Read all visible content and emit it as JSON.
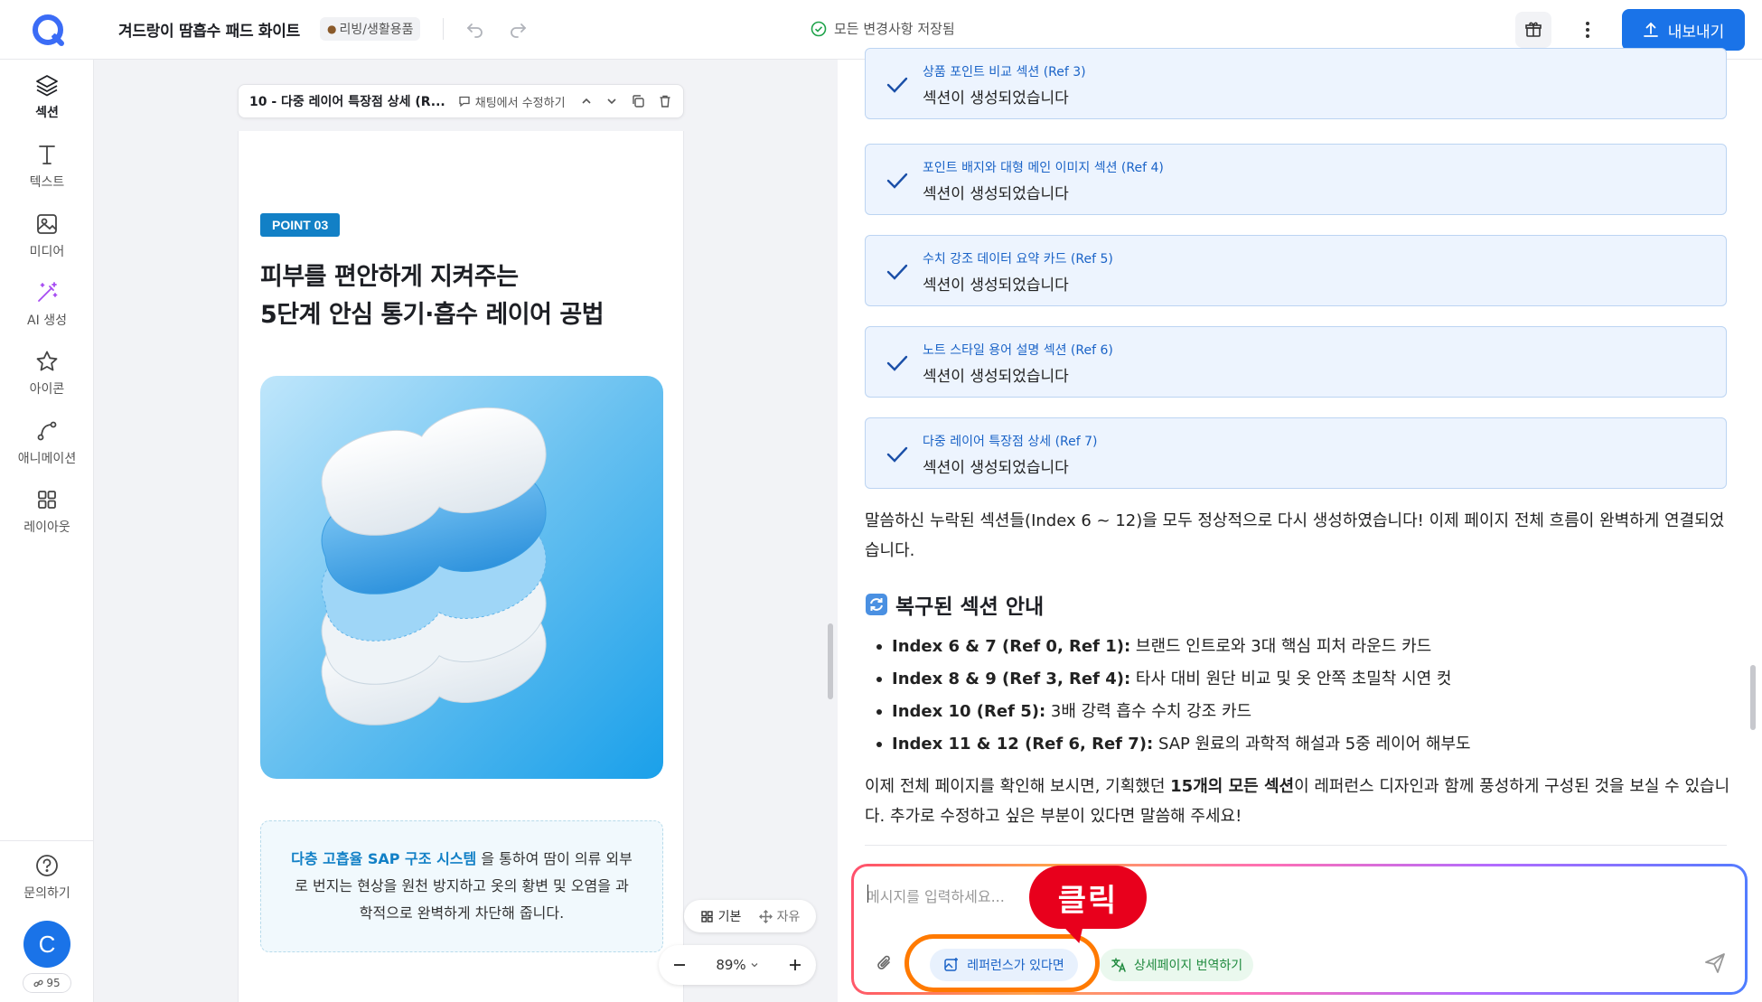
{
  "app": {
    "doc_title": "겨드랑이 땀흡수 패드 화이트",
    "category": "리빙/생활용품",
    "save_status": "모든 변경사항 저장됨",
    "export_label": "내보내기",
    "accent_color": "#1a73e8"
  },
  "sidebar": {
    "items": [
      {
        "label": "섹션",
        "icon": "layers-icon"
      },
      {
        "label": "텍스트",
        "icon": "text-icon"
      },
      {
        "label": "미디어",
        "icon": "image-icon"
      },
      {
        "label": "AI 생성",
        "icon": "magic-wand-icon"
      },
      {
        "label": "아이콘",
        "icon": "star-icon"
      },
      {
        "label": "애니메이션",
        "icon": "curve-icon"
      },
      {
        "label": "레이아웃",
        "icon": "grid-icon"
      }
    ],
    "help_label": "문의하기",
    "avatar_initial": "C",
    "credits": "95"
  },
  "editor": {
    "section_title": "10 - 다중 레이어 특장점 상세 (R...",
    "edit_in_chat": "채팅에서 수정하기",
    "point_badge": "POINT 03",
    "headline_line1": "피부를 편안하게 지켜주는",
    "headline_line2": "5단계 안심 통기·흡수 레이어 공법",
    "desc_highlight": "다층 고흡율 SAP 구조 시스템",
    "desc_rest": " 을 통하여 땀이 의류 외부로 번지는 현상을 원천 방지하고 옷의 황변 및 오염을 과학적으로 완벽하게 차단해 줍니다.",
    "mode_basic": "기본",
    "mode_free": "자유",
    "zoom": "89%"
  },
  "chat": {
    "cards": [
      {
        "title": "상품 포인트 비교 섹션 (Ref 3)",
        "status": "섹션이 생성되었습니다"
      },
      {
        "title": "포인트 배지와 대형 메인 이미지 섹션 (Ref 4)",
        "status": "섹션이 생성되었습니다"
      },
      {
        "title": "수치 강조 데이터 요약 카드 (Ref 5)",
        "status": "섹션이 생성되었습니다"
      },
      {
        "title": "노트 스타일 용어 설명 섹션 (Ref 6)",
        "status": "섹션이 생성되었습니다"
      },
      {
        "title": "다중 레이어 특장점 상세 (Ref 7)",
        "status": "섹션이 생성되었습니다"
      }
    ],
    "message1": "말씀하신 누락된 섹션들(Index 6 ~ 12)을 모두 정상적으로 다시 생성하였습니다! 이제 페이지 전체 흐름이 완벽하게 연결되었습니다.",
    "subheading": "복구된 섹션 안내",
    "bullets": [
      {
        "bold": "Index 6 & 7 (Ref 0, Ref 1):",
        "text": " 브랜드 인트로와 3대 핵심 피처 라운드 카드"
      },
      {
        "bold": "Index 8 & 9 (Ref 3, Ref 4):",
        "text": " 타사 대비 원단 비교 및 옷 안쪽 초밀착 시연 컷"
      },
      {
        "bold": "Index 10 (Ref 5):",
        "text": " 3배 강력 흡수 수치 강조 카드"
      },
      {
        "bold": "Index 11 & 12 (Ref 6, Ref 7):",
        "text": " SAP 원료의 과학적 해설과 5중 레이어 해부도"
      }
    ],
    "closing_pre": "이제 전체 페이지를 확인해 보시면, 기획했던 ",
    "closing_bold": "15개의 모든 섹션",
    "closing_post": "이 레퍼런스 디자인과 함께 풍성하게 구성된 것을 보실 수 있습니다. 추가로 수정하고 싶은 부분이 있다면 말씀해 주세요!",
    "input_placeholder": "메시지를 입력하세요...",
    "ref_button": "레퍼런스가 있다면",
    "translate_button": "상세페이지 번역하기"
  },
  "annotation": {
    "callout": "클릭",
    "callout_color": "#e8001c",
    "ring_color": "#ff7a00"
  }
}
